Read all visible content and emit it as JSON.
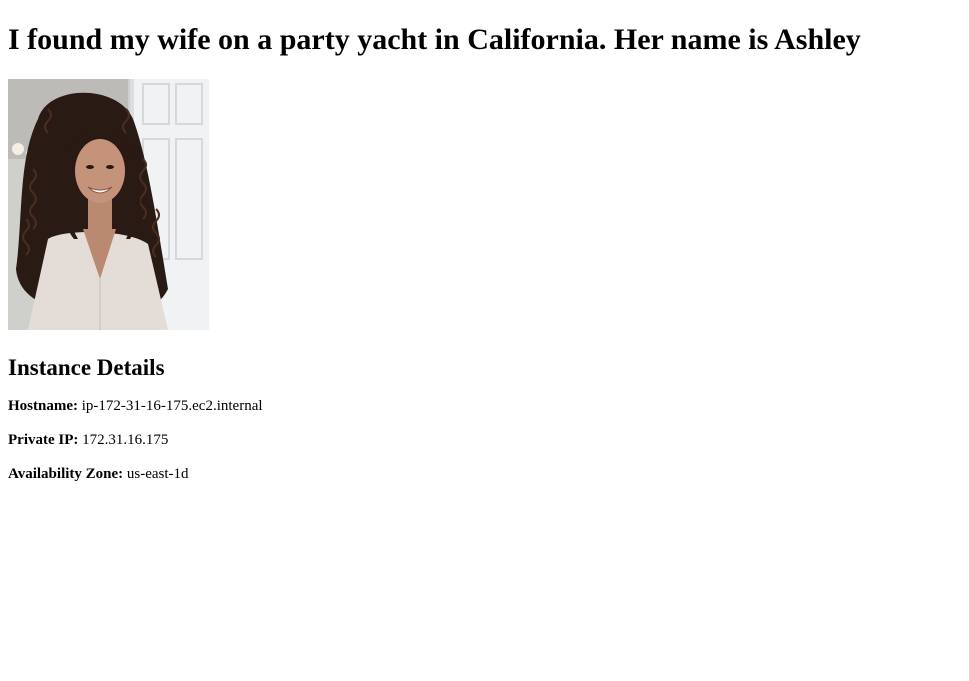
{
  "page": {
    "title": "I found my wife on a party yacht in California. Her name is Ashley"
  },
  "photo": {
    "subject": "smiling-woman-portrait"
  },
  "instance": {
    "heading": "Instance Details",
    "hostname_label": "Hostname:",
    "hostname_value": "ip-172-31-16-175.ec2.internal",
    "private_ip_label": "Private IP:",
    "private_ip_value": "172.31.16.175",
    "availability_zone_label": "Availability Zone:",
    "availability_zone_value": "us-east-1d"
  }
}
